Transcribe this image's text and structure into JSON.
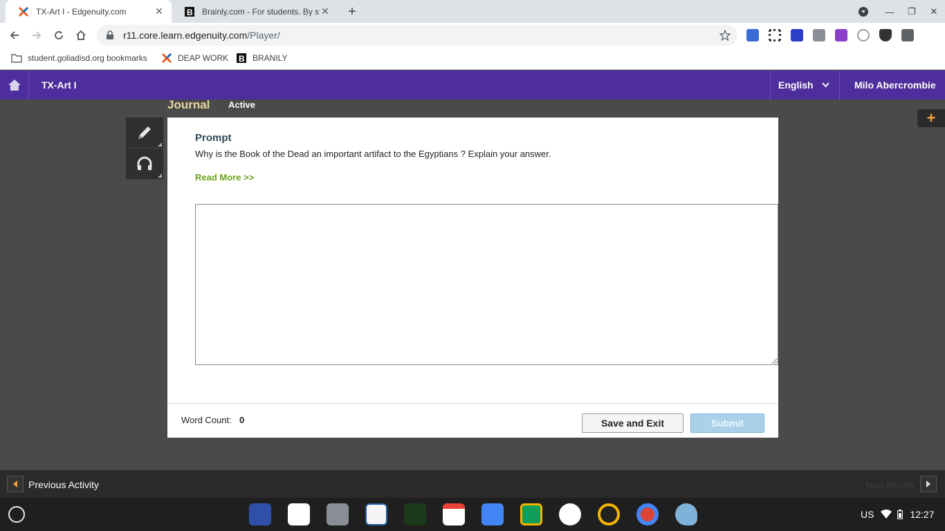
{
  "browser": {
    "tabs": [
      {
        "title": "TX-Art I - Edgenuity.com",
        "icon": "edgenuity-x-icon",
        "active": true
      },
      {
        "title": "Brainly.com - For students. By st",
        "icon": "brainly-icon",
        "active": false
      }
    ],
    "url_host": "r11.core.learn.edgenuity.com",
    "url_path": "/Player/",
    "bookmarks": [
      {
        "label": "student.goliadisd.org bookmarks",
        "icon": "folder-icon"
      },
      {
        "label": "DEAP WORK",
        "icon": "edgenuity-x-icon"
      },
      {
        "label": "BRANILY",
        "icon": "brainly-icon"
      }
    ]
  },
  "app": {
    "course": "TX-Art I",
    "language": "English",
    "user": "Milo Abercrombie"
  },
  "activity": {
    "type": "Journal",
    "status": "Active",
    "prompt_label": "Prompt",
    "prompt_text": "Why is the Book of the Dead an important artifact to the Egyptians ? Explain your answer.",
    "read_more": "Read More >>",
    "answer_value": "",
    "word_count_label": "Word Count:",
    "word_count": "0",
    "save_label": "Save and Exit",
    "submit_label": "Submit"
  },
  "footer": {
    "previous": "Previous Activity",
    "next": "Next Activity"
  },
  "shelf": {
    "locale": "US",
    "time": "12:27"
  },
  "colors": {
    "header": "#4d2e9c",
    "journal_title": "#e8d7a0",
    "read_more": "#6aa31c",
    "submit_disabled": "#a9d1ea"
  }
}
